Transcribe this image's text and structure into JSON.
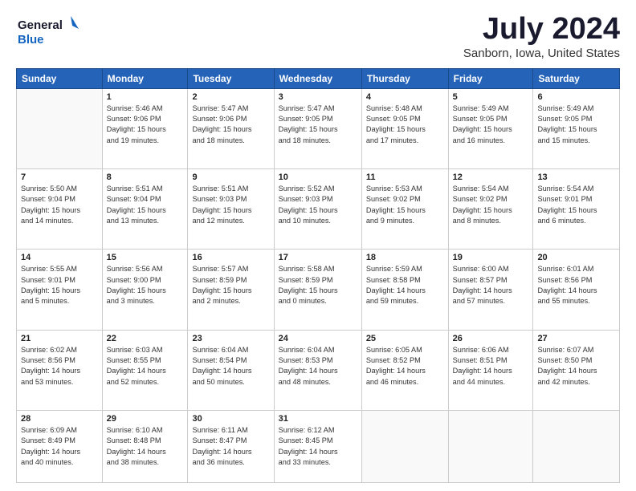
{
  "logo": {
    "line1": "General",
    "line2": "Blue"
  },
  "title": "July 2024",
  "subtitle": "Sanborn, Iowa, United States",
  "weekdays": [
    "Sunday",
    "Monday",
    "Tuesday",
    "Wednesday",
    "Thursday",
    "Friday",
    "Saturday"
  ],
  "weeks": [
    [
      {
        "day": "",
        "info": ""
      },
      {
        "day": "1",
        "info": "Sunrise: 5:46 AM\nSunset: 9:06 PM\nDaylight: 15 hours\nand 19 minutes."
      },
      {
        "day": "2",
        "info": "Sunrise: 5:47 AM\nSunset: 9:06 PM\nDaylight: 15 hours\nand 18 minutes."
      },
      {
        "day": "3",
        "info": "Sunrise: 5:47 AM\nSunset: 9:05 PM\nDaylight: 15 hours\nand 18 minutes."
      },
      {
        "day": "4",
        "info": "Sunrise: 5:48 AM\nSunset: 9:05 PM\nDaylight: 15 hours\nand 17 minutes."
      },
      {
        "day": "5",
        "info": "Sunrise: 5:49 AM\nSunset: 9:05 PM\nDaylight: 15 hours\nand 16 minutes."
      },
      {
        "day": "6",
        "info": "Sunrise: 5:49 AM\nSunset: 9:05 PM\nDaylight: 15 hours\nand 15 minutes."
      }
    ],
    [
      {
        "day": "7",
        "info": "Sunrise: 5:50 AM\nSunset: 9:04 PM\nDaylight: 15 hours\nand 14 minutes."
      },
      {
        "day": "8",
        "info": "Sunrise: 5:51 AM\nSunset: 9:04 PM\nDaylight: 15 hours\nand 13 minutes."
      },
      {
        "day": "9",
        "info": "Sunrise: 5:51 AM\nSunset: 9:03 PM\nDaylight: 15 hours\nand 12 minutes."
      },
      {
        "day": "10",
        "info": "Sunrise: 5:52 AM\nSunset: 9:03 PM\nDaylight: 15 hours\nand 10 minutes."
      },
      {
        "day": "11",
        "info": "Sunrise: 5:53 AM\nSunset: 9:02 PM\nDaylight: 15 hours\nand 9 minutes."
      },
      {
        "day": "12",
        "info": "Sunrise: 5:54 AM\nSunset: 9:02 PM\nDaylight: 15 hours\nand 8 minutes."
      },
      {
        "day": "13",
        "info": "Sunrise: 5:54 AM\nSunset: 9:01 PM\nDaylight: 15 hours\nand 6 minutes."
      }
    ],
    [
      {
        "day": "14",
        "info": "Sunrise: 5:55 AM\nSunset: 9:01 PM\nDaylight: 15 hours\nand 5 minutes."
      },
      {
        "day": "15",
        "info": "Sunrise: 5:56 AM\nSunset: 9:00 PM\nDaylight: 15 hours\nand 3 minutes."
      },
      {
        "day": "16",
        "info": "Sunrise: 5:57 AM\nSunset: 8:59 PM\nDaylight: 15 hours\nand 2 minutes."
      },
      {
        "day": "17",
        "info": "Sunrise: 5:58 AM\nSunset: 8:59 PM\nDaylight: 15 hours\nand 0 minutes."
      },
      {
        "day": "18",
        "info": "Sunrise: 5:59 AM\nSunset: 8:58 PM\nDaylight: 14 hours\nand 59 minutes."
      },
      {
        "day": "19",
        "info": "Sunrise: 6:00 AM\nSunset: 8:57 PM\nDaylight: 14 hours\nand 57 minutes."
      },
      {
        "day": "20",
        "info": "Sunrise: 6:01 AM\nSunset: 8:56 PM\nDaylight: 14 hours\nand 55 minutes."
      }
    ],
    [
      {
        "day": "21",
        "info": "Sunrise: 6:02 AM\nSunset: 8:56 PM\nDaylight: 14 hours\nand 53 minutes."
      },
      {
        "day": "22",
        "info": "Sunrise: 6:03 AM\nSunset: 8:55 PM\nDaylight: 14 hours\nand 52 minutes."
      },
      {
        "day": "23",
        "info": "Sunrise: 6:04 AM\nSunset: 8:54 PM\nDaylight: 14 hours\nand 50 minutes."
      },
      {
        "day": "24",
        "info": "Sunrise: 6:04 AM\nSunset: 8:53 PM\nDaylight: 14 hours\nand 48 minutes."
      },
      {
        "day": "25",
        "info": "Sunrise: 6:05 AM\nSunset: 8:52 PM\nDaylight: 14 hours\nand 46 minutes."
      },
      {
        "day": "26",
        "info": "Sunrise: 6:06 AM\nSunset: 8:51 PM\nDaylight: 14 hours\nand 44 minutes."
      },
      {
        "day": "27",
        "info": "Sunrise: 6:07 AM\nSunset: 8:50 PM\nDaylight: 14 hours\nand 42 minutes."
      }
    ],
    [
      {
        "day": "28",
        "info": "Sunrise: 6:09 AM\nSunset: 8:49 PM\nDaylight: 14 hours\nand 40 minutes."
      },
      {
        "day": "29",
        "info": "Sunrise: 6:10 AM\nSunset: 8:48 PM\nDaylight: 14 hours\nand 38 minutes."
      },
      {
        "day": "30",
        "info": "Sunrise: 6:11 AM\nSunset: 8:47 PM\nDaylight: 14 hours\nand 36 minutes."
      },
      {
        "day": "31",
        "info": "Sunrise: 6:12 AM\nSunset: 8:45 PM\nDaylight: 14 hours\nand 33 minutes."
      },
      {
        "day": "",
        "info": ""
      },
      {
        "day": "",
        "info": ""
      },
      {
        "day": "",
        "info": ""
      }
    ]
  ]
}
